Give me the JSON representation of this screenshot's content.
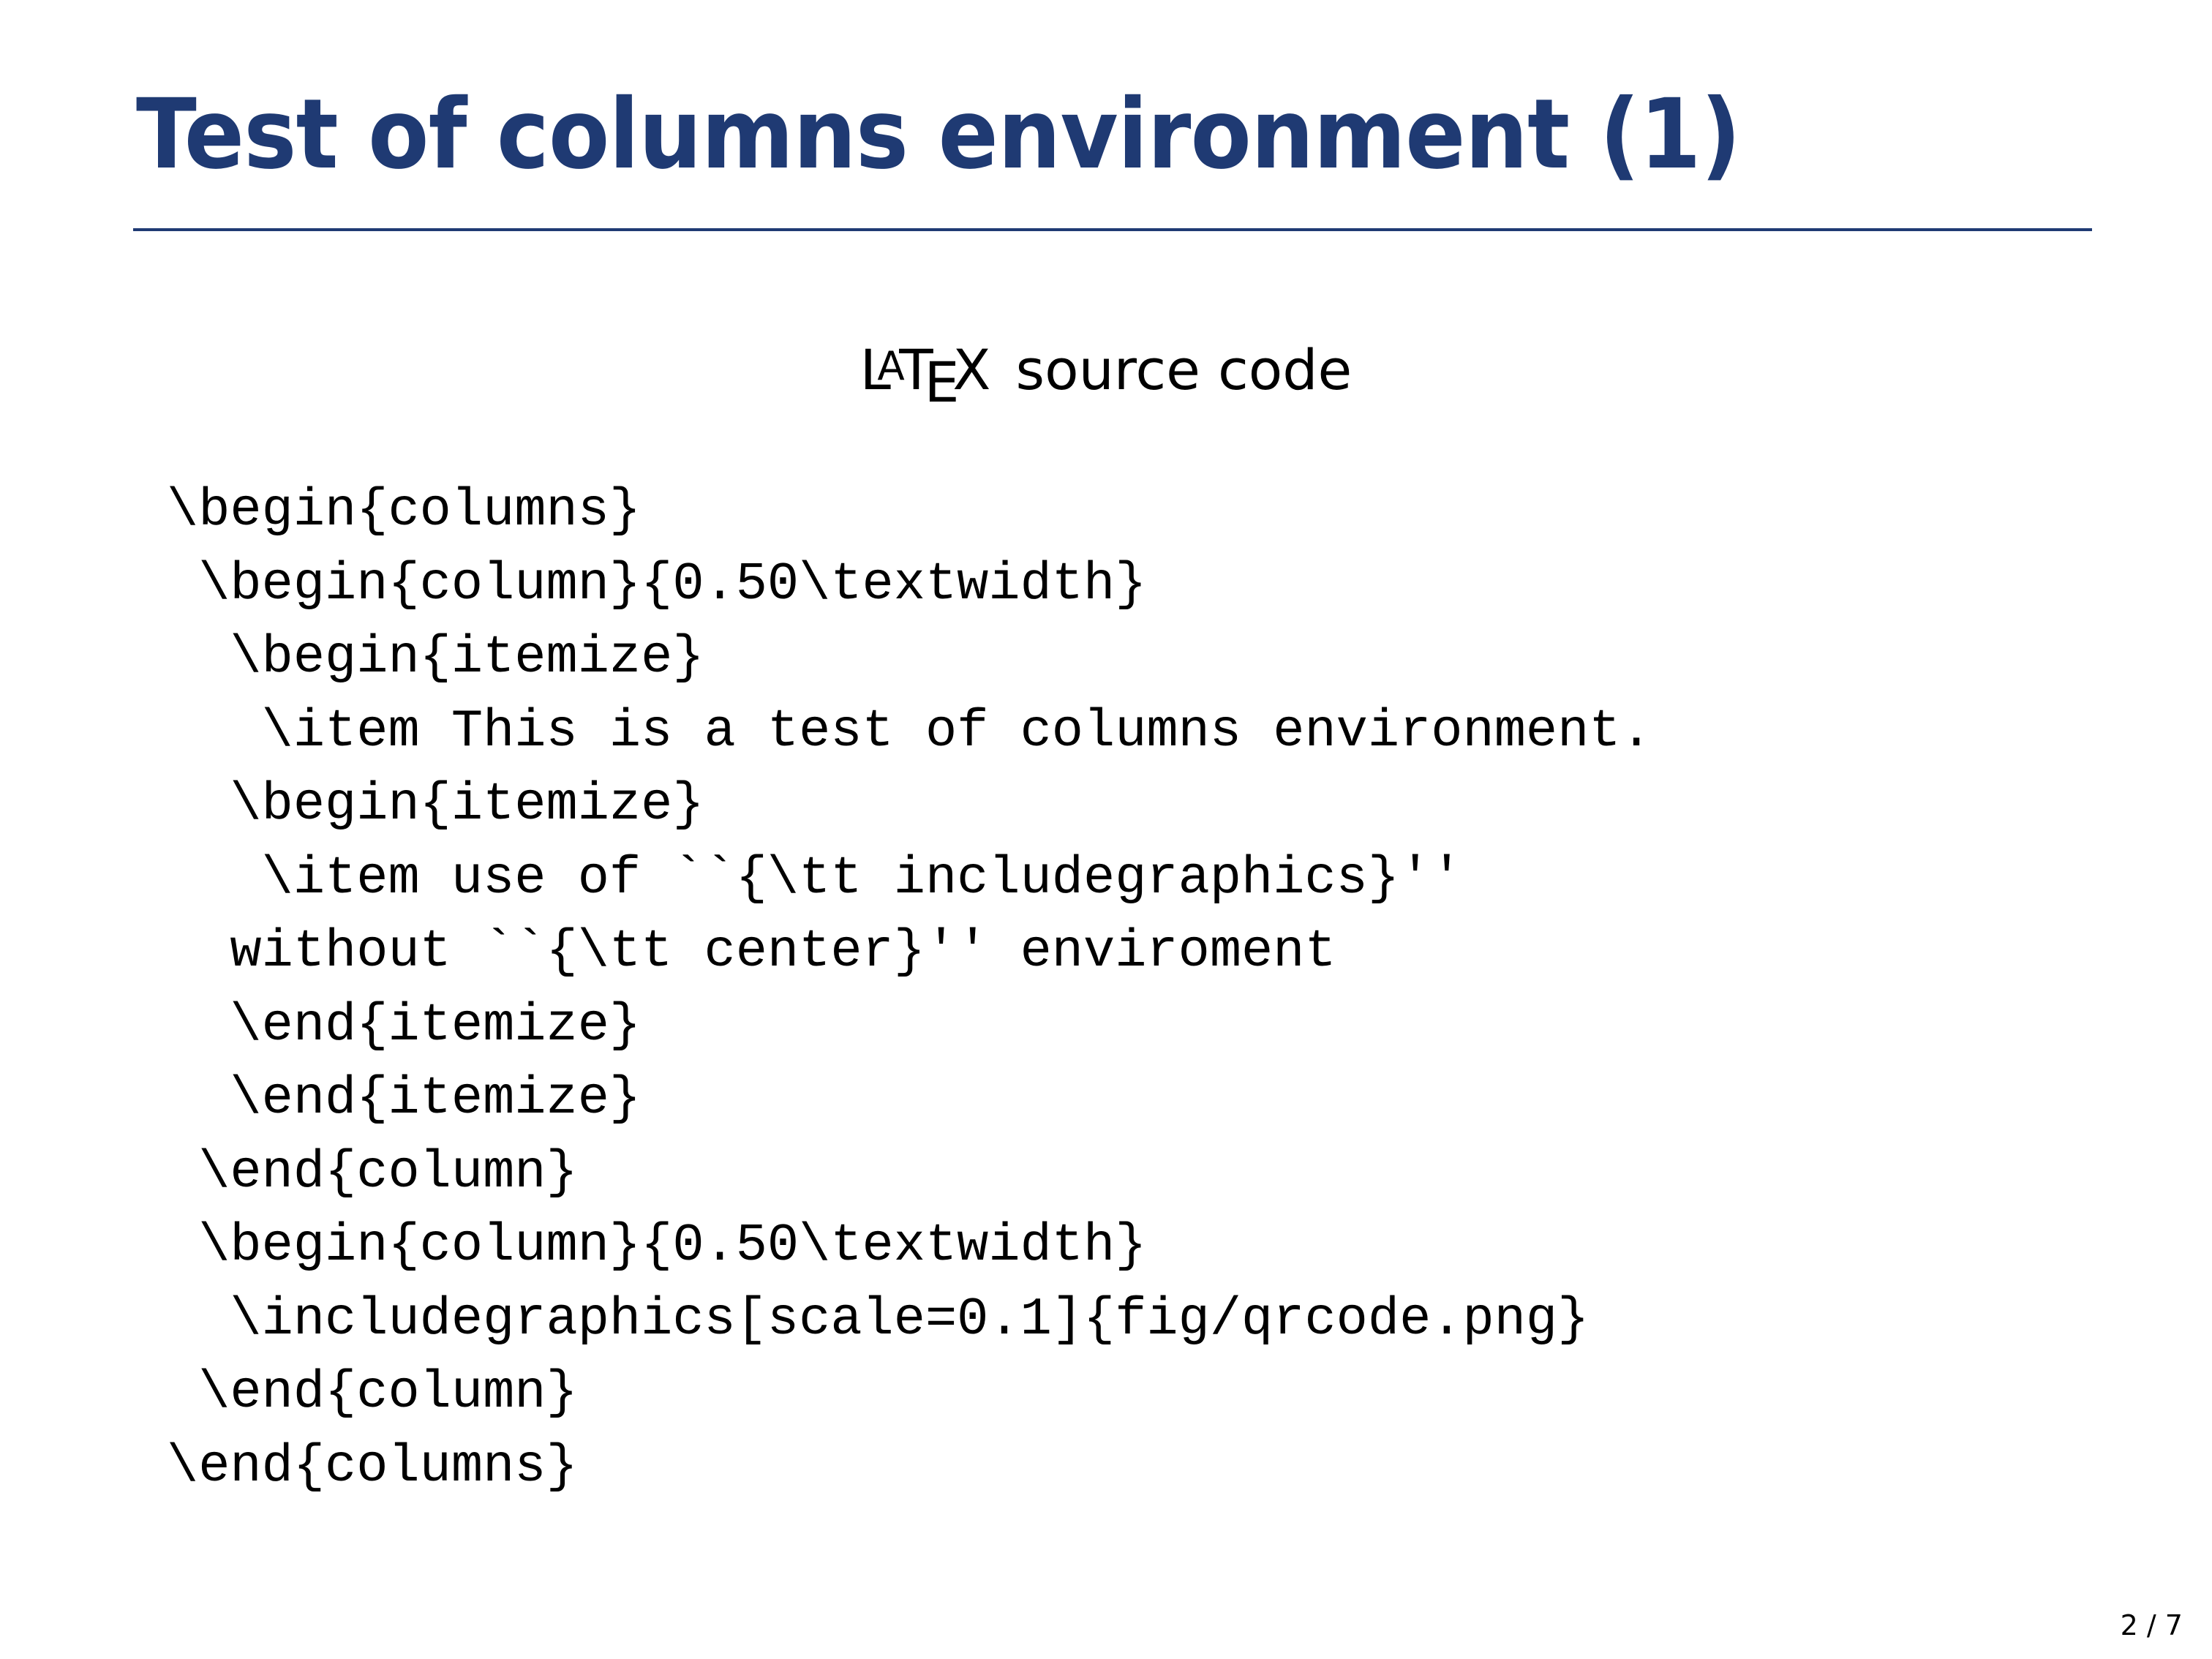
{
  "slide": {
    "title": "Test of columns environment (1)",
    "accent_color": "#1f3a73",
    "block": {
      "heading_logo": {
        "l": "L",
        "a": "A",
        "t": "T",
        "e": "E",
        "x": "X"
      },
      "heading_text": "source code",
      "code_lines": [
        "\\begin{columns}",
        " \\begin{column}{0.50\\textwidth}",
        "  \\begin{itemize}",
        "   \\item This is a test of columns environment.",
        "  \\begin{itemize}",
        "   \\item use of ``{\\tt includegraphics}''",
        "  without ``{\\tt center}'' enviroment",
        "  \\end{itemize}",
        "  \\end{itemize}",
        " \\end{column}",
        " \\begin{column}{0.50\\textwidth}",
        "  \\includegraphics[scale=0.1]{fig/qrcode.png}",
        " \\end{column}",
        "\\end{columns}"
      ]
    },
    "page_number": {
      "current": "2",
      "total": "7",
      "display": "2 / 7"
    }
  }
}
